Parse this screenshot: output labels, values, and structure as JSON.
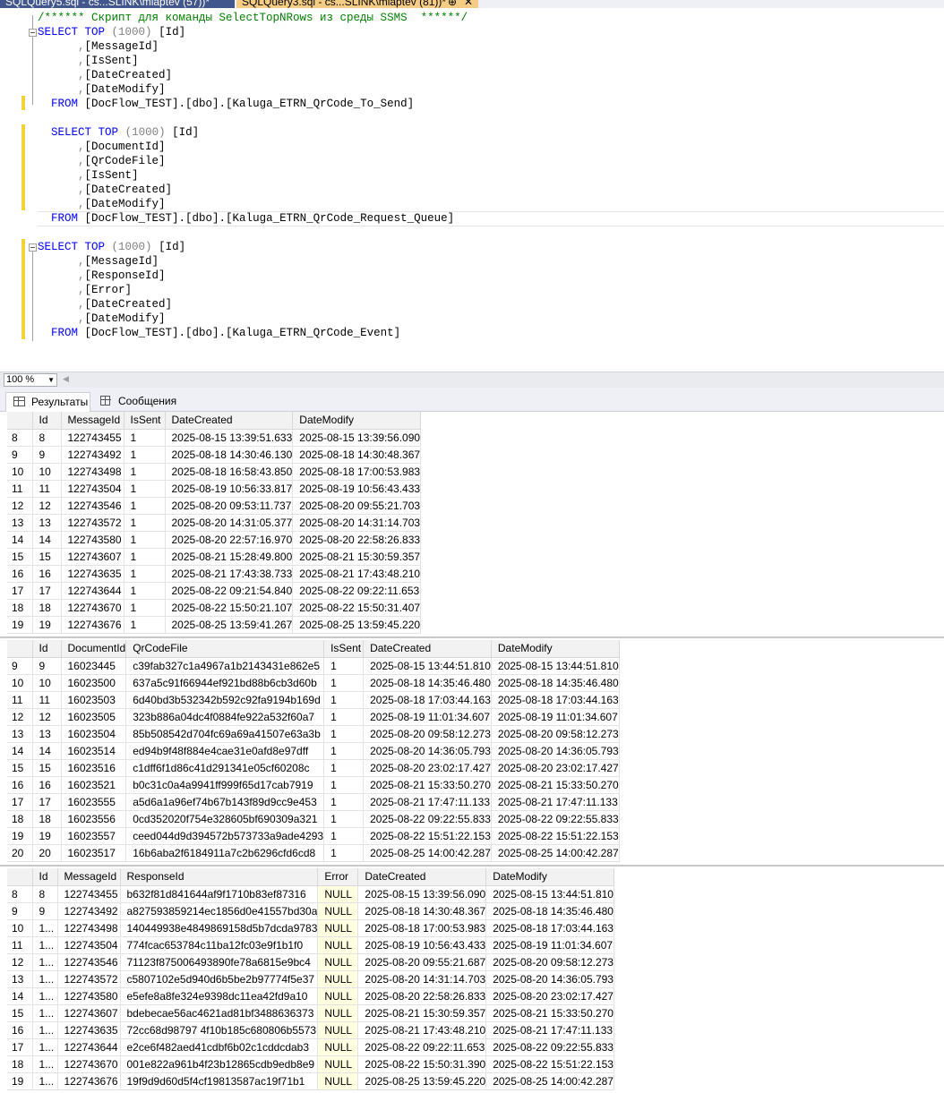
{
  "tabs": [
    {
      "label": "SQLQuery5.sql - cs...SLINK\\mlaptev (57))*",
      "pin": "⊕"
    },
    {
      "label": "SQLQuery3.sql - cs...SLINK\\mlaptev (81))*",
      "pin": "⊕",
      "close": "✕"
    }
  ],
  "editor": {
    "comment": "/****** Скрипт для команды SelectTopNRows из среды SSMS  ******/",
    "queries": [
      {
        "select": "SELECT",
        "top": "TOP",
        "top_n": " (1000) ",
        "first_col": "[Id]",
        "columns": [
          "[MessageId]",
          "[IsSent]",
          "[DateCreated]",
          "[DateModify]"
        ],
        "from": "FROM",
        "table": " [DocFlow_TEST].[dbo].[Kaluga_ETRN_QrCode_To_Send]"
      },
      {
        "select": "SELECT",
        "top": "TOP",
        "top_n": " (1000) ",
        "first_col": "[Id]",
        "columns": [
          "[DocumentId]",
          "[QrCodeFile]",
          "[IsSent]",
          "[DateCreated]",
          "[DateModify]"
        ],
        "from": "FROM",
        "table": " [DocFlow_TEST].[dbo].[Kaluga_ETRN_QrCode_Request_Queue]"
      },
      {
        "select": "SELECT",
        "top": "TOP",
        "top_n": " (1000) ",
        "first_col": "[Id]",
        "columns": [
          "[MessageId]",
          "[ResponseId]",
          "[Error]",
          "[DateCreated]",
          "[DateModify]"
        ],
        "from": "FROM",
        "table": " [DocFlow_TEST].[dbo].[Kaluga_ETRN_QrCode_Event]"
      }
    ]
  },
  "zoom": "100 %",
  "result_tabs": [
    "Результаты",
    "Сообщения"
  ],
  "colors": {
    "keyword": "#0000ff",
    "comment": "#008000",
    "null_cell": "#ffffe1",
    "active_tab": "#f5cc84",
    "inactive_tab": "#40568d"
  },
  "grids": [
    {
      "columns": [
        "",
        "Id",
        "MessageId",
        "IsSent",
        "DateCreated",
        "DateModify"
      ],
      "rows": [
        [
          "8",
          "8",
          "122743455",
          "1",
          "2025-08-15 13:39:51.633",
          "2025-08-15 13:39:56.090"
        ],
        [
          "9",
          "9",
          "122743492",
          "1",
          "2025-08-18 14:30:46.130",
          "2025-08-18 14:30:48.367"
        ],
        [
          "10",
          "10",
          "122743498",
          "1",
          "2025-08-18 16:58:43.850",
          "2025-08-18 17:00:53.983"
        ],
        [
          "11",
          "11",
          "122743504",
          "1",
          "2025-08-19 10:56:33.817",
          "2025-08-19 10:56:43.433"
        ],
        [
          "12",
          "12",
          "122743546",
          "1",
          "2025-08-20 09:53:11.737",
          "2025-08-20 09:55:21.703"
        ],
        [
          "13",
          "13",
          "122743572",
          "1",
          "2025-08-20 14:31:05.377",
          "2025-08-20 14:31:14.703"
        ],
        [
          "14",
          "14",
          "122743580",
          "1",
          "2025-08-20 22:57:16.970",
          "2025-08-20 22:58:26.833"
        ],
        [
          "15",
          "15",
          "122743607",
          "1",
          "2025-08-21 15:28:49.800",
          "2025-08-21 15:30:59.357"
        ],
        [
          "16",
          "16",
          "122743635",
          "1",
          "2025-08-21 17:43:38.733",
          "2025-08-21 17:43:48.210"
        ],
        [
          "17",
          "17",
          "122743644",
          "1",
          "2025-08-22 09:21:54.840",
          "2025-08-22 09:22:11.653"
        ],
        [
          "18",
          "18",
          "122743670",
          "1",
          "2025-08-22 15:50:21.107",
          "2025-08-22 15:50:31.407"
        ],
        [
          "19",
          "19",
          "122743676",
          "1",
          "2025-08-25 13:59:41.267",
          "2025-08-25 13:59:45.220"
        ]
      ]
    },
    {
      "columns": [
        "",
        "Id",
        "DocumentId",
        "QrCodeFile",
        "IsSent",
        "DateCreated",
        "DateModify"
      ],
      "rows": [
        [
          "9",
          "9",
          "16023445",
          "c39fab327c1a4967a1b2143431e862e5",
          "1",
          "2025-08-15 13:44:51.810",
          "2025-08-15 13:44:51.810"
        ],
        [
          "10",
          "10",
          "16023500",
          "637a5c91f66944ef921bd88b6cb3d60b",
          "1",
          "2025-08-18 14:35:46.480",
          "2025-08-18 14:35:46.480"
        ],
        [
          "11",
          "11",
          "16023503",
          "6d40bd3b532342b592c92fa9194b169d",
          "1",
          "2025-08-18 17:03:44.163",
          "2025-08-18 17:03:44.163"
        ],
        [
          "12",
          "12",
          "16023505",
          "323b886a04dc4f0884fe922a532f60a7",
          "1",
          "2025-08-19 11:01:34.607",
          "2025-08-19 11:01:34.607"
        ],
        [
          "13",
          "13",
          "16023504",
          "85b508542d704fc69a69a41507e63a3b",
          "1",
          "2025-08-20 09:58:12.273",
          "2025-08-20 09:58:12.273"
        ],
        [
          "14",
          "14",
          "16023514",
          "ed94b9f48f884e4cae31e0afd8e97dff",
          "1",
          "2025-08-20 14:36:05.793",
          "2025-08-20 14:36:05.793"
        ],
        [
          "15",
          "15",
          "16023516",
          "c1dff6f1d86c41d291341e05cf60208c",
          "1",
          "2025-08-20 23:02:17.427",
          "2025-08-20 23:02:17.427"
        ],
        [
          "16",
          "16",
          "16023521",
          "b0c31c0a4a9941ff999f65d17cab7919",
          "1",
          "2025-08-21 15:33:50.270",
          "2025-08-21 15:33:50.270"
        ],
        [
          "17",
          "17",
          "16023555",
          "a5d6a1a96ef74b67b143f89d9cc9e453",
          "1",
          "2025-08-21 17:47:11.133",
          "2025-08-21 17:47:11.133"
        ],
        [
          "18",
          "18",
          "16023556",
          "0cd352020f754e328605bf690309a321",
          "1",
          "2025-08-22 09:22:55.833",
          "2025-08-22 09:22:55.833"
        ],
        [
          "19",
          "19",
          "16023557",
          "ceed044d9d394572b573733a9ade4293",
          "1",
          "2025-08-22 15:51:22.153",
          "2025-08-22 15:51:22.153"
        ],
        [
          "20",
          "20",
          "16023517",
          "16b6aba2f6184911a7c2b6296cfd6cd8",
          "1",
          "2025-08-25 14:00:42.287",
          "2025-08-25 14:00:42.287"
        ]
      ]
    },
    {
      "columns": [
        "",
        "Id",
        "MessageId",
        "ResponseId",
        "Error",
        "DateCreated",
        "DateModify"
      ],
      "rows": [
        [
          "8",
          "8",
          "122743455",
          "b632f81d841644af9f1710b83ef87316",
          "NULL",
          "2025-08-15 13:39:56.090",
          "2025-08-15 13:44:51.810"
        ],
        [
          "9",
          "9",
          "122743492",
          "a827593859214ec1856d0e41557bd30a",
          "NULL",
          "2025-08-18 14:30:48.367",
          "2025-08-18 14:35:46.480"
        ],
        [
          "10",
          "1...",
          "122743498",
          "140449938e4849869158d5b7dcda9783",
          "NULL",
          "2025-08-18 17:00:53.983",
          "2025-08-18 17:03:44.163"
        ],
        [
          "11",
          "1...",
          "122743504",
          "774fcac653784c11ba12fc03e9f1b1f0",
          "NULL",
          "2025-08-19 10:56:43.433",
          "2025-08-19 11:01:34.607"
        ],
        [
          "12",
          "1...",
          "122743546",
          "71123f875006493890fe78a6815e9bc4",
          "NULL",
          "2025-08-20 09:55:21.687",
          "2025-08-20 09:58:12.273"
        ],
        [
          "13",
          "1...",
          "122743572",
          "c5807102e5d940d6b5be2b97774f5e37",
          "NULL",
          "2025-08-20 14:31:14.703",
          "2025-08-20 14:36:05.793"
        ],
        [
          "14",
          "1...",
          "122743580",
          "e5efe8a8fe324e9398dc11ea42fd9a10",
          "NULL",
          "2025-08-20 22:58:26.833",
          "2025-08-20 23:02:17.427"
        ],
        [
          "15",
          "1...",
          "122743607",
          "bdebecae56ac4621ad81bf3488636373",
          "NULL",
          "2025-08-21 15:30:59.357",
          "2025-08-21 15:33:50.270"
        ],
        [
          "16",
          "1...",
          "122743635",
          "72cc68d98797 4f10b185c680806b5573",
          "NULL",
          "2025-08-21 17:43:48.210",
          "2025-08-21 17:47:11.133"
        ],
        [
          "17",
          "1...",
          "122743644",
          "e2ce6f482aed41cdbf6b02c1cddcdab3",
          "NULL",
          "2025-08-22 09:22:11.653",
          "2025-08-22 09:22:55.833"
        ],
        [
          "18",
          "1...",
          "122743670",
          "001e822a961b4f23b12865cdb9edb8e9",
          "NULL",
          "2025-08-22 15:50:31.390",
          "2025-08-22 15:51:22.153"
        ],
        [
          "19",
          "1...",
          "122743676",
          "19f9d9d60d5f4cf19813587ac19f71b1",
          "NULL",
          "2025-08-25 13:59:45.220",
          "2025-08-25 14:00:42.287"
        ]
      ]
    }
  ]
}
